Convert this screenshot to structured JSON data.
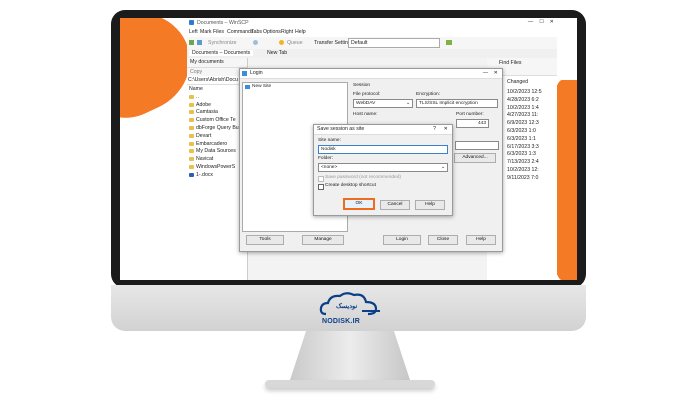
{
  "app": {
    "title": "Documents – WinSCP",
    "menu": [
      "Left",
      "Mark",
      "Files",
      "Commands",
      "Tabs",
      "Options",
      "Right",
      "Help"
    ],
    "toolbar": {
      "synchronize": "Synchronize",
      "queue": "Queue",
      "transfer_settings": "Transfer Settings",
      "transfer_value": "Default"
    },
    "tabs": {
      "tab1": "Documents – Documents",
      "tab2": "New Tab"
    },
    "left_panel": {
      "location": "My documents",
      "path": "C:\\Users\\Abrish\\Docu",
      "column": "Name",
      "items": [
        "..",
        "Adobe",
        "Camtasia",
        "Custom Office Te",
        "dbForge Query Bu",
        "Devart",
        "Embarcadero",
        "My Data Sources",
        "Navicat",
        "WindowsPowerS",
        "1-.docx"
      ],
      "copy": "Copy"
    },
    "right_panel": {
      "find_files": "Find Files",
      "column": "Changed",
      "dates": [
        "10/2/2023 12:5",
        "4/28/2023 6:2",
        "10/2/2023 1:4",
        "4/27/2023 11:",
        "6/9/2023 12:3",
        "6/3/2023 1:0",
        "6/3/2023 1:1",
        "6/17/2023 3:3",
        "6/3/2023 1:3",
        "7/13/2023 2:4",
        "10/2/2023 12:",
        "9/11/2023 7:0"
      ]
    }
  },
  "login": {
    "title": "Login",
    "new_site": "New Site",
    "session_label": "Session",
    "file_protocol_label": "File protocol:",
    "file_protocol": "WebDAV",
    "encryption_label": "Encryption:",
    "encryption": "TLS/SSL Implicit encryption",
    "host_label": "Host name:",
    "port_label": "Port number:",
    "port": "443",
    "advanced": "Advanced...",
    "tools": "Tools",
    "manage": "Manage",
    "login_btn": "Login",
    "close": "Close",
    "help": "Help"
  },
  "save_dialog": {
    "title": "Save session as site",
    "site_name_label": "Site name:",
    "site_name": "Nodisk",
    "folder_label": "Folder:",
    "folder": "<none>",
    "save_password": "Save password (not recommended)",
    "create_shortcut": "Create desktop shortcut",
    "ok": "OK",
    "cancel": "Cancel",
    "help": "Help"
  },
  "branding": {
    "name": "NODISK.IR",
    "fa": "نودیسک"
  },
  "colors": {
    "accent": "#f47a26",
    "highlight": "#f26b1d",
    "brand": "#0d3f88"
  }
}
